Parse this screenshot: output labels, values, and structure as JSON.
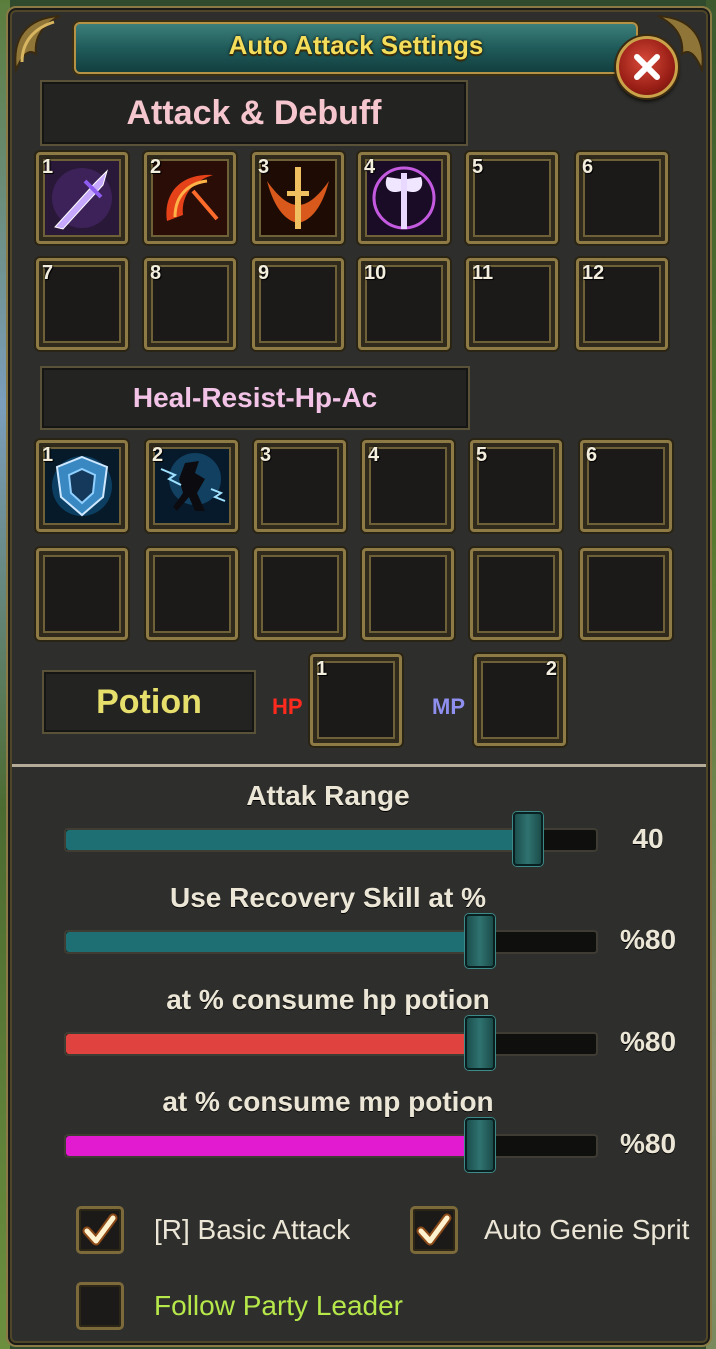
{
  "window": {
    "title": "Auto Attack Settings"
  },
  "attack_section": {
    "label": "Attack & Debuff",
    "slots": [
      {
        "num": "1",
        "icon": "purple-spear-icon"
      },
      {
        "num": "2",
        "icon": "fire-slash-icon"
      },
      {
        "num": "3",
        "icon": "flaming-sword-icon"
      },
      {
        "num": "4",
        "icon": "arcane-axe-icon"
      },
      {
        "num": "5",
        "icon": ""
      },
      {
        "num": "6",
        "icon": ""
      },
      {
        "num": "7",
        "icon": ""
      },
      {
        "num": "8",
        "icon": ""
      },
      {
        "num": "9",
        "icon": ""
      },
      {
        "num": "10",
        "icon": ""
      },
      {
        "num": "11",
        "icon": ""
      },
      {
        "num": "12",
        "icon": ""
      }
    ]
  },
  "heal_section": {
    "label": "Heal-Resist-Hp-Ac",
    "slots": [
      {
        "num": "1",
        "icon": "blue-shield-icon"
      },
      {
        "num": "2",
        "icon": "lightning-dash-icon"
      },
      {
        "num": "3",
        "icon": ""
      },
      {
        "num": "4",
        "icon": ""
      },
      {
        "num": "5",
        "icon": ""
      },
      {
        "num": "6",
        "icon": ""
      },
      {
        "num": "",
        "icon": ""
      },
      {
        "num": "",
        "icon": ""
      },
      {
        "num": "",
        "icon": ""
      },
      {
        "num": "",
        "icon": ""
      },
      {
        "num": "",
        "icon": ""
      },
      {
        "num": "",
        "icon": ""
      }
    ]
  },
  "potion_section": {
    "label": "Potion",
    "hp_label": "HP",
    "mp_label": "MP",
    "hp_slot_num": "1",
    "mp_slot_num": "2"
  },
  "sliders": [
    {
      "label": "Attak Range",
      "value": "40",
      "fraction": 0.87,
      "color": "#1e6f73"
    },
    {
      "label": "Use Recovery Skill at %",
      "value": "%80",
      "fraction": 0.78,
      "color": "#1e6f73"
    },
    {
      "label": "at % consume hp potion",
      "value": "%80",
      "fraction": 0.78,
      "color": "#e0433f"
    },
    {
      "label": "at % consume mp potion",
      "value": "%80",
      "fraction": 0.78,
      "color": "#e21ad0"
    }
  ],
  "checkboxes": {
    "basic_attack": {
      "label": "[R] Basic Attack",
      "checked": true
    },
    "auto_genie": {
      "label": "Auto Genie Sprit",
      "checked": true
    },
    "follow_leader": {
      "label": "Follow Party Leader",
      "checked": false
    }
  },
  "colors": {
    "title": "#f4dd5a",
    "potion_label": "#e7df6c",
    "follow_label": "#b6e84a",
    "hp_label": "#ff2a1e",
    "mp_label": "#8f8ff0"
  }
}
